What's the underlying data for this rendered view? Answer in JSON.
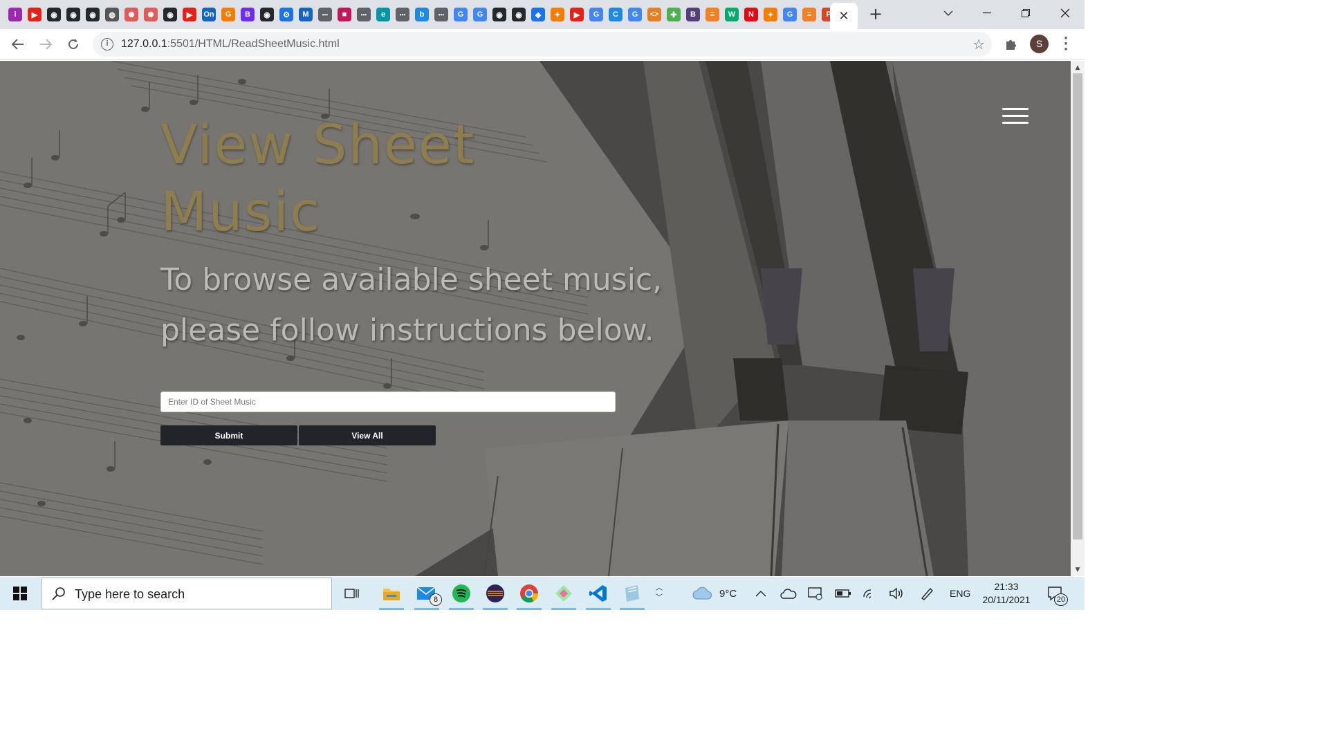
{
  "browser": {
    "favicons": [
      {
        "icon": "info-icon",
        "color": "#9c27b0",
        "glyph": "i"
      },
      {
        "icon": "youtube-icon",
        "color": "#e62117",
        "glyph": "▶"
      },
      {
        "icon": "github-icon",
        "color": "#24292e",
        "glyph": "◉"
      },
      {
        "icon": "github-icon",
        "color": "#24292e",
        "glyph": "◉"
      },
      {
        "icon": "github-icon",
        "color": "#24292e",
        "glyph": "◉"
      },
      {
        "icon": "globe-icon",
        "color": "#555555",
        "glyph": "◍"
      },
      {
        "icon": "openai-icon",
        "color": "#e05a5a",
        "glyph": "✺"
      },
      {
        "icon": "openai-icon",
        "color": "#e05a5a",
        "glyph": "✺"
      },
      {
        "icon": "github-icon",
        "color": "#24292e",
        "glyph": "◉"
      },
      {
        "icon": "youtube-icon",
        "color": "#e62117",
        "glyph": "▶"
      },
      {
        "icon": "on-icon",
        "color": "#1565c0",
        "glyph": "On"
      },
      {
        "icon": "g-orange-icon",
        "color": "#f57c00",
        "glyph": "G"
      },
      {
        "icon": "bootstrap-icon",
        "color": "#6f2cf5",
        "glyph": "B"
      },
      {
        "icon": "github-icon",
        "color": "#24292e",
        "glyph": "◉"
      },
      {
        "icon": "settings-icon",
        "color": "#1a73e8",
        "glyph": "⚙"
      },
      {
        "icon": "mdn-icon",
        "color": "#1565c0",
        "glyph": "M"
      },
      {
        "icon": "dots-icon",
        "color": "#5f6368",
        "glyph": "•••"
      },
      {
        "icon": "app-icon",
        "color": "#c2185b",
        "glyph": "■"
      },
      {
        "icon": "dots-icon",
        "color": "#5f6368",
        "glyph": "•••"
      },
      {
        "icon": "edge-icon",
        "color": "#0097a7",
        "glyph": "e"
      },
      {
        "icon": "dots-icon",
        "color": "#5f6368",
        "glyph": "•••"
      },
      {
        "icon": "bing-icon",
        "color": "#1e88e5",
        "glyph": "b"
      },
      {
        "icon": "dots-icon",
        "color": "#5f6368",
        "glyph": "•••"
      },
      {
        "icon": "google-icon",
        "color": "#4285f4",
        "glyph": "G"
      },
      {
        "icon": "google-icon",
        "color": "#4285f4",
        "glyph": "G"
      },
      {
        "icon": "github-icon",
        "color": "#24292e",
        "glyph": "◉"
      },
      {
        "icon": "github-icon",
        "color": "#24292e",
        "glyph": "◉"
      },
      {
        "icon": "diamond-icon",
        "color": "#1a73e8",
        "glyph": "◆"
      },
      {
        "icon": "figma-icon",
        "color": "#f57c00",
        "glyph": "✦"
      },
      {
        "icon": "youtube-icon",
        "color": "#e62117",
        "glyph": "▶"
      },
      {
        "icon": "google-icon",
        "color": "#4285f4",
        "glyph": "G"
      },
      {
        "icon": "c-icon",
        "color": "#1e88e5",
        "glyph": "C"
      },
      {
        "icon": "google-icon",
        "color": "#4285f4",
        "glyph": "G"
      },
      {
        "icon": "code-icon",
        "color": "#e67e22",
        "glyph": "<>"
      },
      {
        "icon": "slack-icon",
        "color": "#4caf50",
        "glyph": "✚"
      },
      {
        "icon": "bootstrap-icon",
        "color": "#563d7c",
        "glyph": "B"
      },
      {
        "icon": "stackoverflow-icon",
        "color": "#f48024",
        "glyph": "≡"
      },
      {
        "icon": "w3-icon",
        "color": "#04aa6d",
        "glyph": "W"
      },
      {
        "icon": "netflix-icon",
        "color": "#e50914",
        "glyph": "N"
      },
      {
        "icon": "figma-icon",
        "color": "#f57c00",
        "glyph": "✦"
      },
      {
        "icon": "google-icon",
        "color": "#4285f4",
        "glyph": "G"
      },
      {
        "icon": "stackoverflow-icon",
        "color": "#f48024",
        "glyph": "≡"
      },
      {
        "icon": "powerpoint-icon",
        "color": "#d24726",
        "glyph": "P"
      }
    ],
    "active_tab_close": "✕",
    "new_tab": "+",
    "url_host": "127.0.0.1",
    "url_path": ":5501/HTML/ReadSheetMusic.html",
    "profile_initial": "S"
  },
  "page": {
    "title": "View Sheet Music",
    "subtitle": "To browse available sheet music, please follow instructions below.",
    "id_placeholder": "Enter ID of Sheet Music",
    "submit_label": "Submit",
    "view_all_label": "View All",
    "title_color": "#8d7d4f",
    "button_color": "#212529"
  },
  "taskbar": {
    "search_placeholder": "Type here to search",
    "mail_badge": "8",
    "weather": "9°C",
    "language": "ENG",
    "time": "21:33",
    "date": "20/11/2021",
    "notifications": "20"
  }
}
